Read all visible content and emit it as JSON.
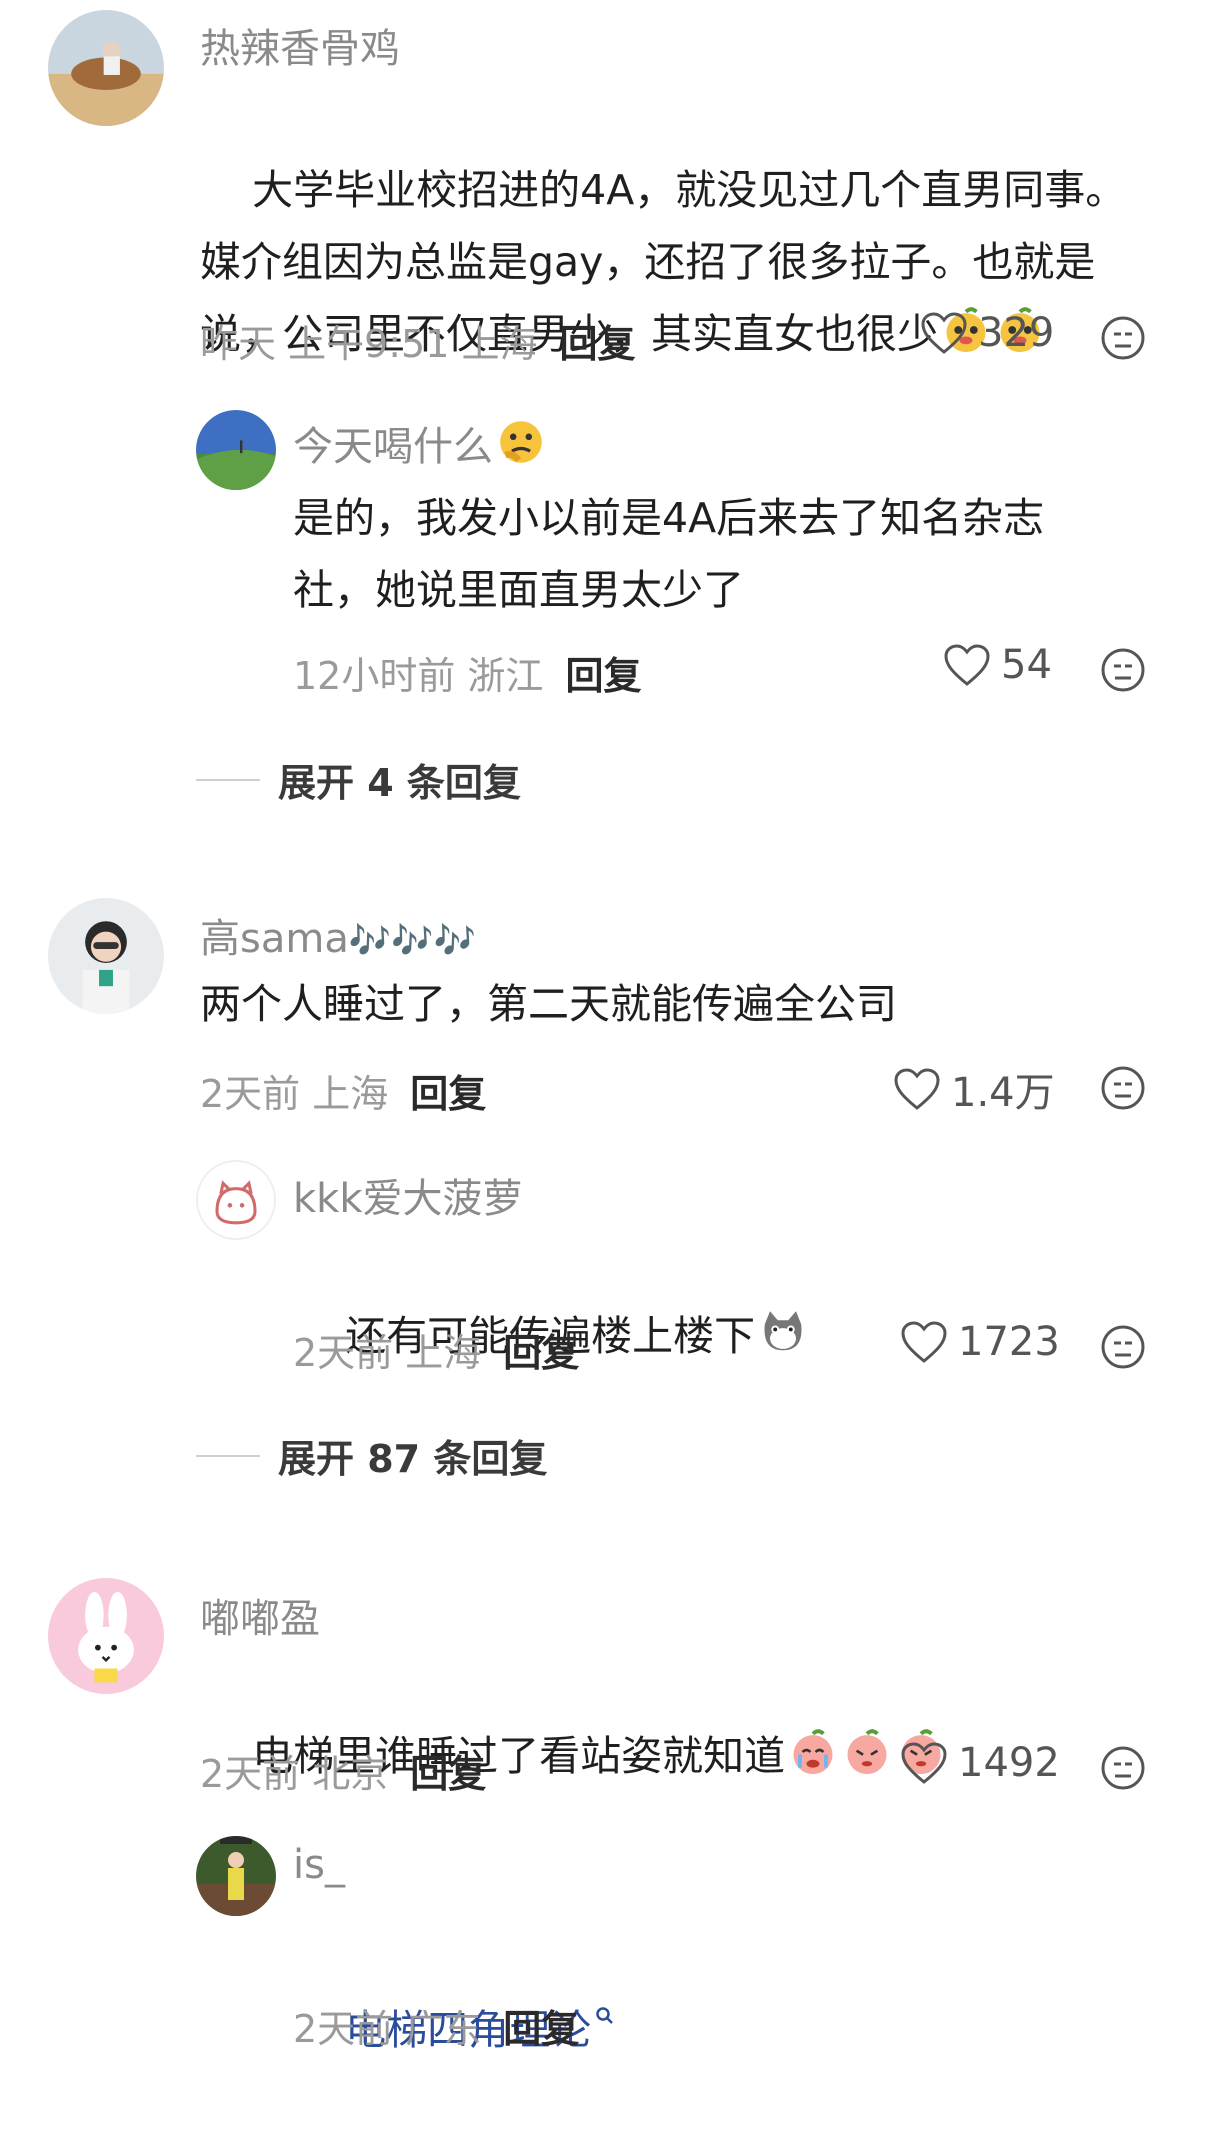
{
  "comments": [
    {
      "author": "热辣香骨鸡",
      "text": "大学毕业校招进的4A，就没见过几个直男同事。\n媒介组因为总监是gay，还招了很多拉子。也就是\n说，公司里不仅直男少，其实直女也很少",
      "time": "昨天 上午9:51 上海",
      "reply": "回复",
      "likes": "329",
      "replies": [
        {
          "author": "今天喝什么",
          "text": "是的，我发小以前是4A后来去了知名杂志\n社，她说里面直男太少了",
          "time": "12小时前 浙江",
          "reply": "回复",
          "likes": "54"
        }
      ],
      "expand": "展开 4 条回复"
    },
    {
      "author": "高sama",
      "author_suffix": "🎶🎶🎶",
      "text": "两个人睡过了，第二天就能传遍全公司",
      "time": "2天前 上海",
      "reply": "回复",
      "likes": "1.4万",
      "replies": [
        {
          "author": "kkk爱大菠萝",
          "text": "还有可能传遍楼上楼下",
          "time": "2天前 上海",
          "reply": "回复",
          "likes": "1723"
        }
      ],
      "expand": "展开 87 条回复"
    },
    {
      "author": "嘟嘟盈",
      "text": "电梯里谁睡过了看站姿就知道",
      "time": "2天前 北京",
      "reply": "回复",
      "likes": "1492",
      "replies": [
        {
          "author": "is_",
          "text": "电梯四角理论",
          "time": "2天前 广东",
          "reply": "回复"
        }
      ]
    }
  ],
  "icons": {
    "like": "heart-outline-icon",
    "dislike": "meh-face-icon"
  },
  "colors": {
    "meta_gray": "#9a9a9a",
    "link_blue": "#2b4b9b"
  }
}
